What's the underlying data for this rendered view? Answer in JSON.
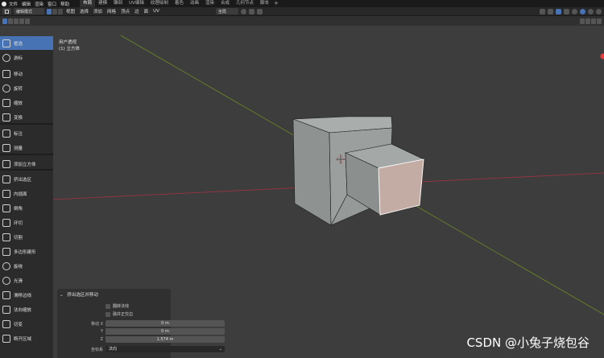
{
  "menubar": {
    "items": [
      "文件",
      "编辑",
      "渲染",
      "窗口",
      "帮助"
    ],
    "workspaces": [
      {
        "label": "布局",
        "active": true
      },
      {
        "label": "建模",
        "active": false
      },
      {
        "label": "雕刻",
        "active": false
      },
      {
        "label": "UV编辑",
        "active": false
      },
      {
        "label": "纹理绘制",
        "active": false
      },
      {
        "label": "着色",
        "active": false
      },
      {
        "label": "动画",
        "active": false
      },
      {
        "label": "渲染",
        "active": false
      },
      {
        "label": "合成",
        "active": false
      },
      {
        "label": "几何节点",
        "active": false
      },
      {
        "label": "脚本",
        "active": false
      }
    ],
    "add_workspace": "+"
  },
  "header": {
    "mode": "编辑模式",
    "menus": [
      "视图",
      "选择",
      "添加",
      "网格",
      "顶点",
      "边",
      "面",
      "UV"
    ],
    "transform_orientation": "全局"
  },
  "viewport": {
    "view_name": "用户透视",
    "object_name": "(1) 立方体"
  },
  "toolbar": {
    "tools": [
      {
        "name": "select-box",
        "label": "框选",
        "active": true
      },
      {
        "name": "cursor",
        "label": "游标",
        "active": false
      },
      {
        "name": "move",
        "label": "移动",
        "active": false
      },
      {
        "name": "rotate",
        "label": "旋转",
        "active": false
      },
      {
        "name": "scale",
        "label": "缩放",
        "active": false
      },
      {
        "name": "transform",
        "label": "变换",
        "active": false
      },
      {
        "name": "annotate",
        "label": "标注",
        "active": false
      },
      {
        "name": "measure",
        "label": "测量",
        "active": false
      },
      {
        "name": "add-cube",
        "label": "添加立方体",
        "active": false
      },
      {
        "name": "extrude-region",
        "label": "挤出选区",
        "active": false
      },
      {
        "name": "inset-faces",
        "label": "内插面",
        "active": false
      },
      {
        "name": "bevel",
        "label": "倒角",
        "active": false
      },
      {
        "name": "loop-cut",
        "label": "环切",
        "active": false
      },
      {
        "name": "knife",
        "label": "切割",
        "active": false
      },
      {
        "name": "poly-build",
        "label": "多边形建形",
        "active": false
      },
      {
        "name": "spin",
        "label": "旋绕",
        "active": false
      },
      {
        "name": "smooth",
        "label": "光滑",
        "active": false
      },
      {
        "name": "edge-slide",
        "label": "滑移边线",
        "active": false
      },
      {
        "name": "shrink-fatten",
        "label": "法向缩放",
        "active": false
      },
      {
        "name": "shear",
        "label": "切变",
        "active": false
      },
      {
        "name": "rip-region",
        "label": "断开区域",
        "active": false
      }
    ]
  },
  "operator_panel": {
    "title": "挤出选区并移动",
    "flip_normals": "翻转法线",
    "dissolve_orthogonal": "融并正交边",
    "move_label": "移动 X",
    "y_label": "Y",
    "z_label": "Z",
    "x_value": "0 m",
    "y_value": "0 m",
    "z_value": "1.574 m",
    "orientation_label": "坐标系",
    "orientation_value": "法向"
  },
  "watermark": "CSDN @小兔子烧包谷",
  "colors": {
    "accent": "#4772b3",
    "viewport_bg": "#3d3d3d",
    "selected_face": "#c2aca4",
    "x_axis": "#a03344",
    "y_axis": "#6b8a25"
  }
}
